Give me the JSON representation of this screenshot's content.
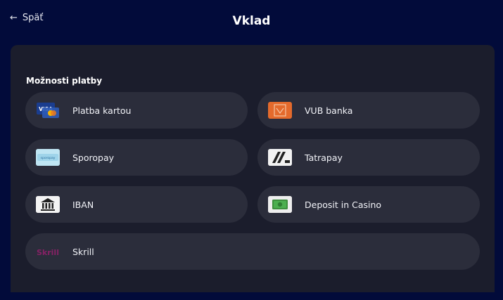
{
  "header": {
    "back_label": "Späť",
    "back_arrow": "←",
    "title": "Vklad"
  },
  "section": {
    "label": "Možnosti platby"
  },
  "options": [
    {
      "label": "Platba kartou",
      "icon": "visa-card-icon"
    },
    {
      "label": "VUB banka",
      "icon": "vub-bank-icon"
    },
    {
      "label": "Sporopay",
      "icon": "sporopay-icon"
    },
    {
      "label": "Tatrapay",
      "icon": "tatrapay-icon"
    },
    {
      "label": "IBAN",
      "icon": "bank-building-icon"
    },
    {
      "label": "Deposit in Casino",
      "icon": "cash-icon"
    },
    {
      "label": "Skrill",
      "icon": "skrill-icon"
    }
  ],
  "logos": {
    "visa_text": "VISA",
    "skrill_text": "Skrill",
    "sporo_text": "sporopay"
  },
  "colors": {
    "background": "#020b3a",
    "panel": "#1b1d2c",
    "option": "#2b2d3b",
    "vub_orange": "#e46a2c",
    "skrill_purple": "#862165",
    "visa_blue": "#1a3d8f"
  }
}
